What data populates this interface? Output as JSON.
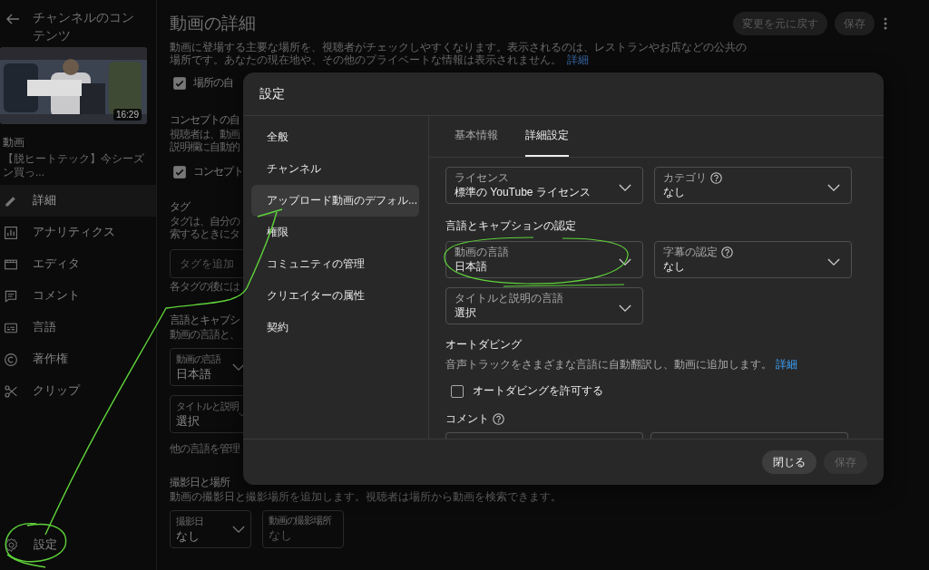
{
  "sidebar": {
    "back_label": "チャンネルのコンテンツ",
    "duration": "16:29",
    "video_heading": "動画",
    "video_title": "【脱ヒートテック】今シーズン買っ...",
    "items": [
      {
        "label": "詳細",
        "selected": true
      },
      {
        "label": "アナリティクス",
        "selected": false
      },
      {
        "label": "エディタ",
        "selected": false
      },
      {
        "label": "コメント",
        "selected": false
      },
      {
        "label": "言語",
        "selected": false
      },
      {
        "label": "著作権",
        "selected": false
      },
      {
        "label": "クリップ",
        "selected": false
      }
    ],
    "settings_label": "設定"
  },
  "page": {
    "title": "動画の詳細",
    "buttons": [
      {
        "label": "変更を元に戻す",
        "disabled": true
      },
      {
        "label": "保存",
        "disabled": true
      }
    ],
    "location_desc": [
      "動画に登場する主要な場所を、視聴者がチェックしやすくなります。表示されるのは、レストランやお店などの公共の",
      "場所です。あなたの現在地や、その他のプライベートな情報は表示されません。"
    ],
    "location_link": "詳細",
    "auto_location": {
      "label": "場所の自",
      "checked": true
    },
    "concept": {
      "heading": "コンセプトの自",
      "lines": [
        "視聴者は、動画",
        "説明欄に自動的"
      ]
    },
    "auto_concept": {
      "label": "コンセプト",
      "checked": true
    },
    "tags": {
      "heading": "タグ",
      "lines": [
        "タグは、自分の",
        "索するときにタ"
      ],
      "placeholder": "タグを追加",
      "hint": "各タグの後には"
    },
    "language": {
      "heading": "言語とキャプシ",
      "lines": [
        "動画の言語と、"
      ],
      "fields": [
        {
          "label": "動画の言語",
          "value": "日本語"
        },
        {
          "label": "タイトルと説明",
          "value": "選択"
        }
      ],
      "hint": "他の言語を管理"
    },
    "recording": {
      "heading": "撮影日と場所",
      "lines": [
        "動画の撮影日と撮影場所を追加します。視聴者は場所から動画を検索できます。"
      ],
      "fields": [
        {
          "kind": "dropdown",
          "label": "撮影日",
          "value": "なし"
        },
        {
          "kind": "input",
          "label": "動画の撮影場所",
          "placeholder": "なし"
        }
      ]
    }
  },
  "dialog": {
    "title": "設定",
    "nav": [
      {
        "label": "全般",
        "selected": false
      },
      {
        "label": "チャンネル",
        "selected": false
      },
      {
        "label": "アップロード動画のデフォル...",
        "selected": true
      },
      {
        "label": "権限",
        "selected": false
      },
      {
        "label": "コミュニティの管理",
        "selected": false
      },
      {
        "label": "クリエイターの属性",
        "selected": false
      },
      {
        "label": "契約",
        "selected": false
      }
    ],
    "tabs": [
      {
        "label": "基本情報",
        "selected": false
      },
      {
        "label": "詳細設定",
        "selected": true
      }
    ],
    "row1": [
      {
        "label": "ライセンス",
        "value": "標準の YouTube ライセンス",
        "help": false
      },
      {
        "label": "カテゴリ",
        "value": "なし",
        "help": true
      }
    ],
    "caption_heading": "言語とキャプションの認定",
    "row2": [
      {
        "label": "動画の言語",
        "value": "日本語",
        "help": false
      },
      {
        "label": "字幕の認定",
        "value": "なし",
        "help": true
      }
    ],
    "row3": [
      {
        "label": "タイトルと説明の言語",
        "value": "選択",
        "help": false
      }
    ],
    "dubbing": {
      "heading": "オートダビング",
      "desc": "音声トラックをさまざまな言語に自動翻訳し、動画に追加します。",
      "link": "詳細",
      "checkbox": {
        "label": "オートダビングを許可する",
        "checked": false
      }
    },
    "comment_heading": "コメント",
    "buttons": [
      {
        "label": "閉じる",
        "disabled": false
      },
      {
        "label": "保存",
        "disabled": true
      }
    ]
  }
}
